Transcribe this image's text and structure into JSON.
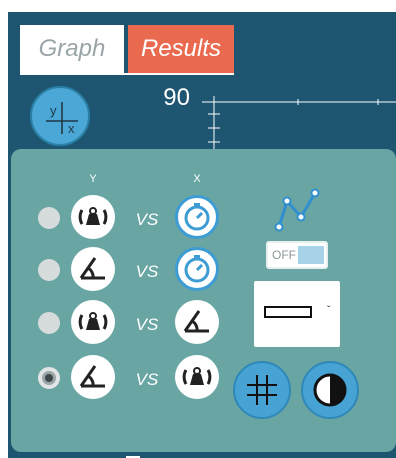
{
  "tabs": [
    {
      "label": "Graph",
      "active": false
    },
    {
      "label": "Results",
      "active": true
    }
  ],
  "axis_selector": {
    "y_label": "y",
    "x_label": "x",
    "value": "90"
  },
  "panel": {
    "column_y": "Y",
    "column_x": "X",
    "vs_label": "VS",
    "rows": [
      {
        "y_icon": "scale-weight-icon",
        "x_icon": "stopwatch-icon",
        "selected": false
      },
      {
        "y_icon": "angle-icon",
        "x_icon": "stopwatch-icon",
        "selected": false
      },
      {
        "y_icon": "scale-weight-icon",
        "x_icon": "angle-icon",
        "selected": false
      },
      {
        "y_icon": "angle-icon",
        "x_icon": "scale-weight-icon",
        "selected": true
      }
    ],
    "toggle": {
      "label": "OFF",
      "state": false
    },
    "graph_style_icon": "line-graph-icon",
    "line_style_icon": "rectangle-line-icon",
    "grid_icon": "grid-icon",
    "contrast_icon": "contrast-icon"
  },
  "colors": {
    "background": "#1e5570",
    "panel": "#68a5a3",
    "results_tab": "#e96a4e",
    "accent_blue": "#47a3d4"
  }
}
